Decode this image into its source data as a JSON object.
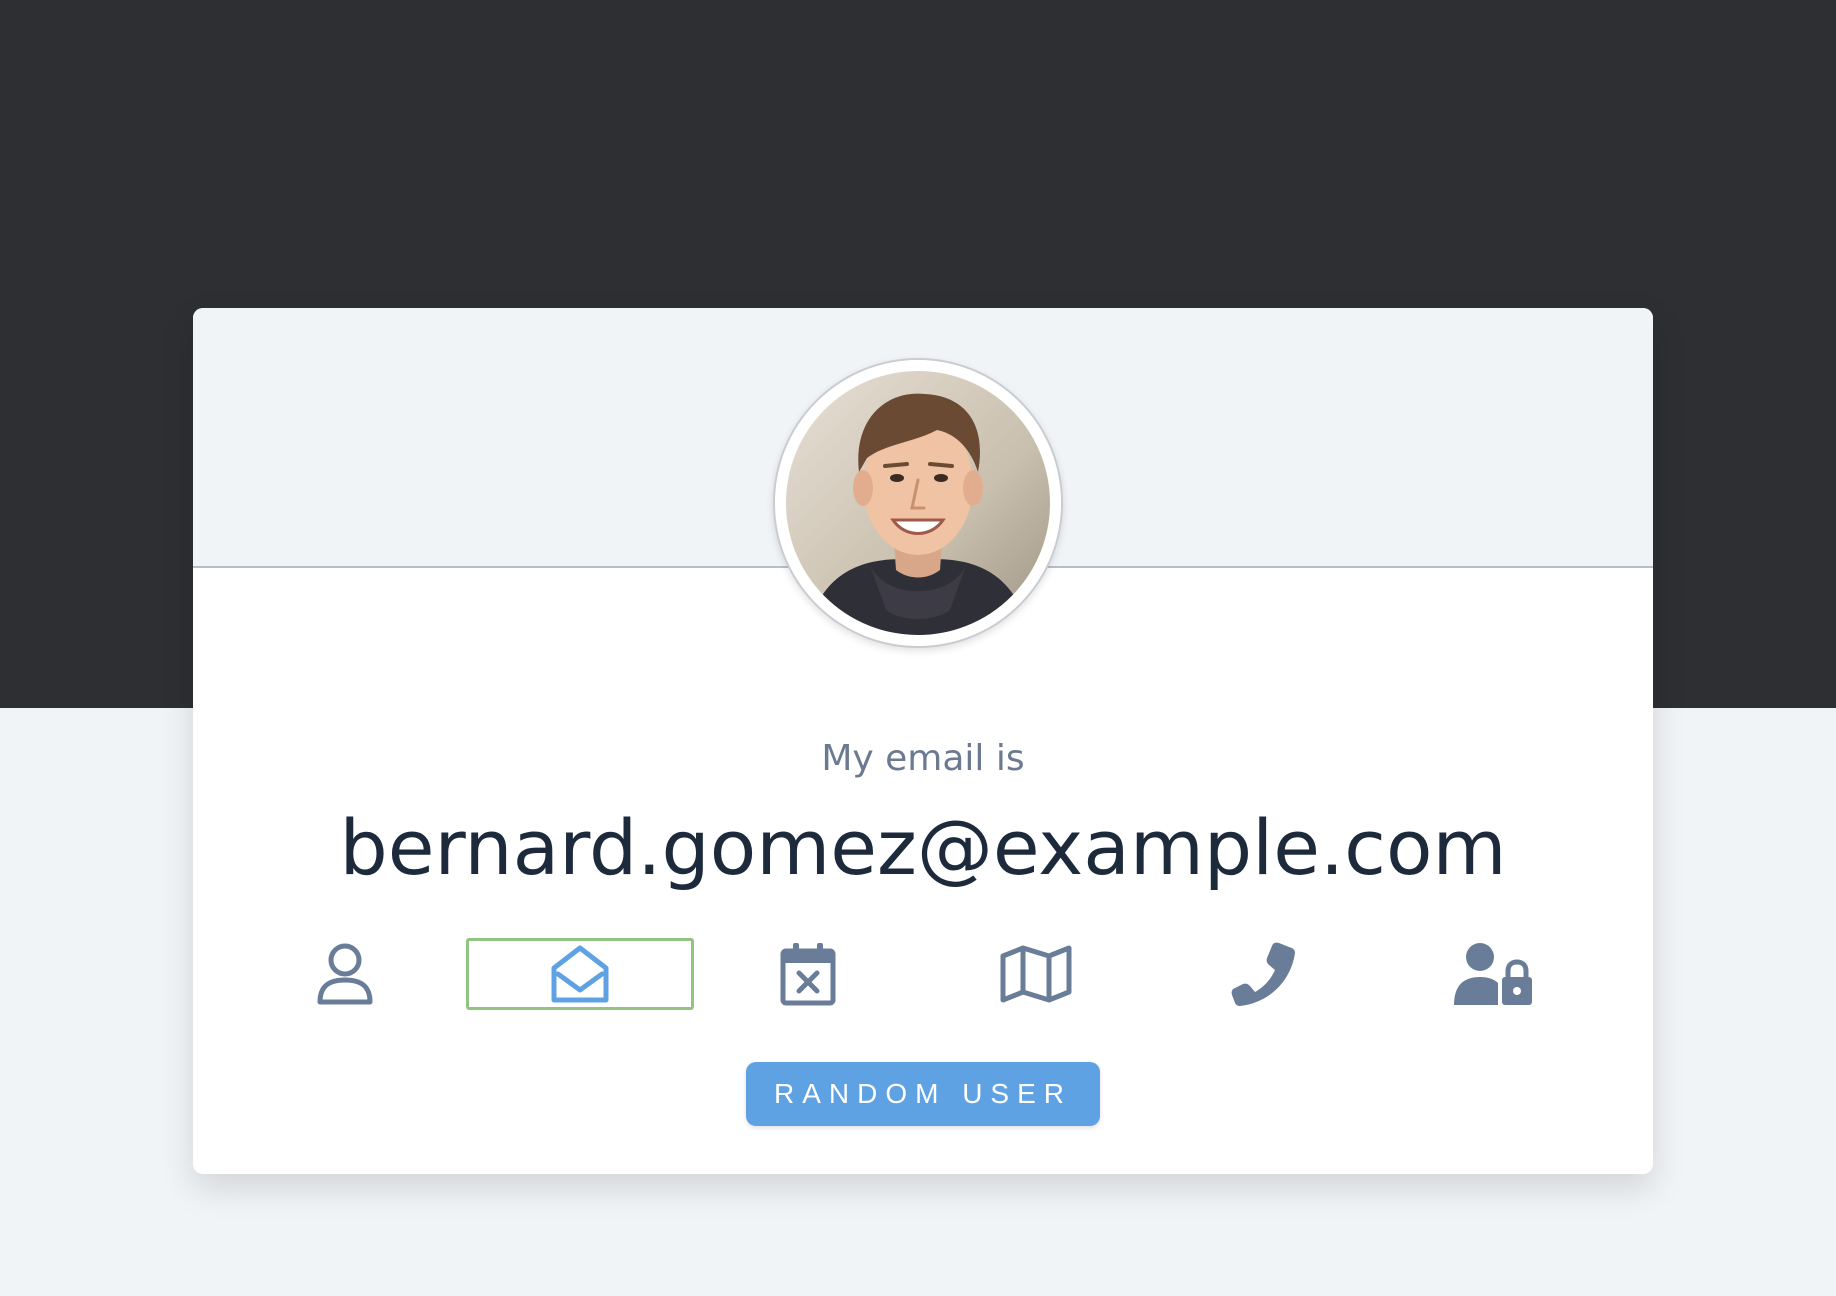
{
  "card": {
    "caption": "My email is",
    "value": "bernard.gomez@example.com",
    "button_label": "RANDOM USER"
  },
  "icons": [
    {
      "name": "user-icon",
      "active": false
    },
    {
      "name": "envelope-open-icon",
      "active": true
    },
    {
      "name": "calendar-x-icon",
      "active": false
    },
    {
      "name": "map-icon",
      "active": false
    },
    {
      "name": "phone-icon",
      "active": false
    },
    {
      "name": "user-lock-icon",
      "active": false
    }
  ],
  "colors": {
    "dark_band": "#2d2f33",
    "page_bg": "#f1f4f7",
    "icon": "#6a7d98",
    "icon_active": "#5fa2e3",
    "active_border": "#92c481",
    "button": "#5fa2e3",
    "text_dark": "#1d2a3c"
  }
}
